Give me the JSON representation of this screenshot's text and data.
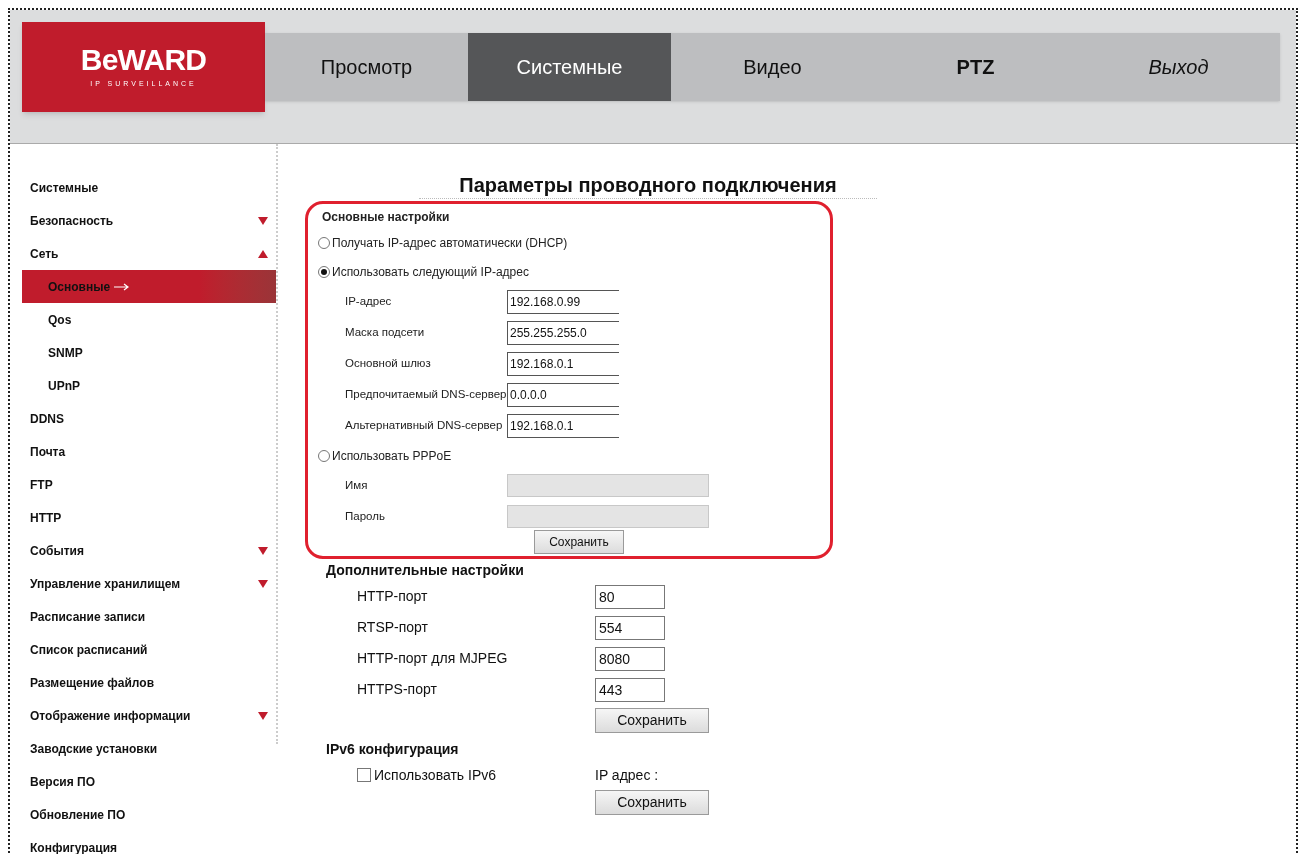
{
  "logo": {
    "name": "BeWARD",
    "tagline": "IP SURVEILLANCE"
  },
  "tabs": [
    {
      "label": "Просмотр",
      "selected": false,
      "kind": "normal"
    },
    {
      "label": "Системные",
      "selected": true,
      "kind": "normal"
    },
    {
      "label": "Видео",
      "selected": false,
      "kind": "normal"
    },
    {
      "label": "PTZ",
      "selected": false,
      "kind": "bold"
    },
    {
      "label": "Выход",
      "selected": false,
      "kind": "italic"
    }
  ],
  "sidebar": {
    "items": [
      {
        "label": "Системные",
        "kind": "link",
        "selected": false
      },
      {
        "label": "Безопасность",
        "kind": "group",
        "expanded": false,
        "selected": false
      },
      {
        "label": "Сеть",
        "kind": "group",
        "expanded": true,
        "selected": false,
        "children": [
          {
            "label": "Основные",
            "selected": true
          },
          {
            "label": "Qos",
            "selected": false
          },
          {
            "label": "SNMP",
            "selected": false
          },
          {
            "label": "UPnP",
            "selected": false
          }
        ]
      },
      {
        "label": "DDNS",
        "kind": "link",
        "selected": false
      },
      {
        "label": "Почта",
        "kind": "link",
        "selected": false
      },
      {
        "label": "FTP",
        "kind": "link",
        "selected": false
      },
      {
        "label": "HTTP",
        "kind": "link",
        "selected": false
      },
      {
        "label": "События",
        "kind": "group",
        "expanded": false,
        "selected": false
      },
      {
        "label": "Управление хранилищем",
        "kind": "group",
        "expanded": false,
        "selected": false
      },
      {
        "label": "Расписание записи",
        "kind": "link",
        "selected": false
      },
      {
        "label": "Список расписаний",
        "kind": "link",
        "selected": false
      },
      {
        "label": "Размещение файлов",
        "kind": "link",
        "selected": false
      },
      {
        "label": "Отображение информации",
        "kind": "group",
        "expanded": false,
        "selected": false
      },
      {
        "label": "Заводские установки",
        "kind": "link",
        "selected": false
      },
      {
        "label": "Версия ПО",
        "kind": "link",
        "selected": false
      },
      {
        "label": "Обновление ПО",
        "kind": "link",
        "selected": false
      },
      {
        "label": "Конфигурация",
        "kind": "link",
        "selected": false
      }
    ]
  },
  "page_title": "Параметры проводного подключения",
  "basic": {
    "title": "Основные настройки",
    "options": [
      {
        "label": "Получать IP-адрес автоматически (DHCP)",
        "selected": false
      },
      {
        "label": "Использовать следующий IP-адрес",
        "selected": true,
        "fields": [
          {
            "label": "IP-адрес",
            "value": "192.168.0.99",
            "disabled": false
          },
          {
            "label": "Маска подсети",
            "value": "255.255.255.0",
            "disabled": false
          },
          {
            "label": "Основной шлюз",
            "value": "192.168.0.1",
            "disabled": false
          },
          {
            "label": "Предпочитаемый DNS-сервер",
            "value": "0.0.0.0",
            "disabled": false
          },
          {
            "label": "Альтернативный DNS-сервер",
            "value": "192.168.0.1",
            "disabled": false
          }
        ]
      },
      {
        "label": "Использовать PPPoE",
        "selected": false,
        "fields": [
          {
            "label": "Имя",
            "disabled": true
          },
          {
            "label": "Пароль",
            "disabled": true
          }
        ]
      }
    ],
    "save": "Сохранить"
  },
  "advanced": {
    "title": "Дополнительные настройки",
    "ports": [
      {
        "label": "HTTP-порт",
        "value": "80"
      },
      {
        "label": "RTSP-порт",
        "value": "554"
      },
      {
        "label": "HTTP-порт для MJPEG",
        "value": "8080"
      },
      {
        "label": "HTTPS-порт",
        "value": "443"
      }
    ],
    "save": "Сохранить"
  },
  "ipv6": {
    "title": "IPv6 конфигурация",
    "checkbox": {
      "label": "Использовать IPv6",
      "checked": false
    },
    "address_label": "IP адрес :",
    "save": "Сохранить"
  }
}
